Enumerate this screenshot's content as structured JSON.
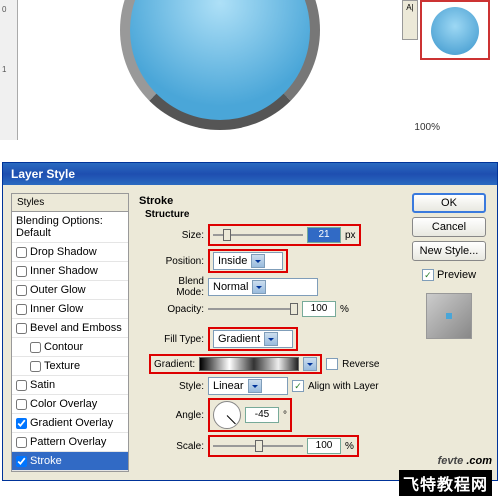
{
  "ruler": {
    "t1": "0",
    "t2": "1"
  },
  "toolbar_glyph": "A|",
  "zoom": "100%",
  "dialog": {
    "title": "Layer Style",
    "styles_header": "Styles",
    "blending_default": "Blending Options: Default",
    "styles": [
      {
        "label": "Drop Shadow",
        "checked": false
      },
      {
        "label": "Inner Shadow",
        "checked": false
      },
      {
        "label": "Outer Glow",
        "checked": false
      },
      {
        "label": "Inner Glow",
        "checked": false
      },
      {
        "label": "Bevel and Emboss",
        "checked": false
      },
      {
        "label": "Contour",
        "checked": false,
        "indent": true
      },
      {
        "label": "Texture",
        "checked": false,
        "indent": true
      },
      {
        "label": "Satin",
        "checked": false
      },
      {
        "label": "Color Overlay",
        "checked": false
      },
      {
        "label": "Gradient Overlay",
        "checked": true
      },
      {
        "label": "Pattern Overlay",
        "checked": false
      },
      {
        "label": "Stroke",
        "checked": true,
        "active": true
      }
    ],
    "stroke": {
      "group": "Stroke",
      "structure": "Structure",
      "size_label": "Size:",
      "size_value": "21",
      "px": "px",
      "position_label": "Position:",
      "position_value": "Inside",
      "blend_label": "Blend Mode:",
      "blend_value": "Normal",
      "opacity_label": "Opacity:",
      "opacity_value": "100",
      "pct": "%",
      "filltype_label": "Fill Type:",
      "filltype_value": "Gradient",
      "gradient_label": "Gradient:",
      "reverse_label": "Reverse",
      "align_label": "Align with Layer",
      "style_label": "Style:",
      "style_value": "Linear",
      "angle_label": "Angle:",
      "angle_value": "-45",
      "deg": "°",
      "scale_label": "Scale:",
      "scale_value": "100"
    },
    "buttons": {
      "ok": "OK",
      "cancel": "Cancel",
      "newstyle": "New Style...",
      "preview": "Preview"
    }
  },
  "watermark": {
    "line1a": "fevte",
    "line1b": " .com",
    "line2": "飞特教程网"
  }
}
